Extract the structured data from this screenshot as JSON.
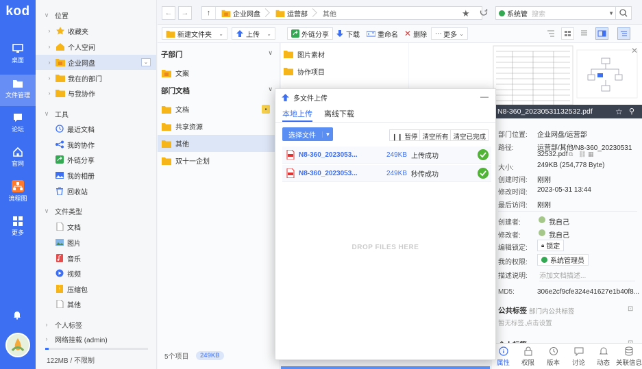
{
  "rail": {
    "logo": "kod",
    "items": [
      {
        "label": "桌面",
        "icon": "desktop-icon"
      },
      {
        "label": "文件管理",
        "icon": "folder-icon"
      },
      {
        "label": "论坛",
        "icon": "forum-icon"
      },
      {
        "label": "官网",
        "icon": "home-icon"
      },
      {
        "label": "流程图",
        "icon": "flowchart-icon"
      },
      {
        "label": "更多",
        "icon": "grid-icon"
      }
    ]
  },
  "tree": {
    "location_header": "位置",
    "location_items": [
      {
        "label": "收藏夹",
        "icon": "star-icon"
      },
      {
        "label": "个人空间",
        "icon": "house-icon"
      },
      {
        "label": "企业网盘",
        "icon": "enterprise-folder-icon"
      },
      {
        "label": "我在的部门",
        "icon": "folder-icon"
      },
      {
        "label": "与我协作",
        "icon": "folder-icon"
      }
    ],
    "tools_header": "工具",
    "tools_items": [
      {
        "label": "最近文档",
        "icon": "clock-icon"
      },
      {
        "label": "我的协作",
        "icon": "share-nodes-icon"
      },
      {
        "label": "外链分享",
        "icon": "link-share-icon"
      },
      {
        "label": "我的相册",
        "icon": "album-icon"
      },
      {
        "label": "回收站",
        "icon": "trash-icon"
      }
    ],
    "types_header": "文件类型",
    "types_items": [
      {
        "label": "文档",
        "icon": "doc-icon"
      },
      {
        "label": "图片",
        "icon": "image-icon"
      },
      {
        "label": "音乐",
        "icon": "music-icon"
      },
      {
        "label": "视频",
        "icon": "video-icon"
      },
      {
        "label": "压缩包",
        "icon": "zip-icon"
      },
      {
        "label": "其他",
        "icon": "file-icon"
      }
    ],
    "tags_header": "个人标签",
    "network_header": "网络挂载 (admin)",
    "quota": "122MB / 不限制"
  },
  "topbar": {
    "crumbs": [
      "企业网盘",
      "运营部",
      "其他"
    ],
    "user_label": "系统管",
    "search_placeholder": "搜索"
  },
  "toolbar": {
    "new_folder": "新建文件夹",
    "upload": "上传",
    "share": "外链分享",
    "download": "下载",
    "rename": "重命名",
    "delete": "删除",
    "more": "更多"
  },
  "pane1": {
    "sub_header": "子部门",
    "sub_items": [
      "文案"
    ],
    "dept_header": "部门文档",
    "dept_items": [
      "文档",
      "共享资源",
      "其他",
      "双十一企划"
    ],
    "footer_count": "5个项目",
    "footer_size": "249KB"
  },
  "pane2": {
    "items": [
      "图片素材",
      "协作项目"
    ]
  },
  "dialog": {
    "title": "多文件上传",
    "tab_local": "本地上传",
    "tab_offline": "离线下载",
    "pick": "选择文件",
    "pause": "暂停",
    "clear_all": "清空所有",
    "clear_done": "清空已完成",
    "files": [
      {
        "name": "N8-360_2023053...",
        "size": "249KB",
        "status": "上传成功"
      },
      {
        "name": "N8-360_2023053...",
        "size": "249KB",
        "status": "秒传成功"
      }
    ],
    "drop_hint": "DROP FILES HERE"
  },
  "info": {
    "file_title": "N8-360_20230531132532.pdf",
    "rows": [
      {
        "k": "部门位置:",
        "v": "企业网盘/运营部"
      },
      {
        "k": "路径:",
        "v": "运营部/其他/N8-360_20230531"
      },
      {
        "k": "",
        "v": "32532.pdf"
      },
      {
        "k": "大小:",
        "v": "249KB (254,778 Byte)"
      },
      {
        "k": "创建时间:",
        "v": "刚刚"
      },
      {
        "k": "修改时间:",
        "v": "2023-05-31 13:44"
      },
      {
        "k": "最后访问:",
        "v": "刚刚"
      },
      {
        "k": "创建者:",
        "v": "我自己"
      },
      {
        "k": "修改者:",
        "v": "我自己"
      },
      {
        "k": "编辑锁定:",
        "v": "锁定"
      },
      {
        "k": "我的权限:",
        "v": "系统管理员"
      },
      {
        "k": "描述说明:",
        "v": "添加文档描述..."
      },
      {
        "k": "MD5:",
        "v": "306e2cf9cfe324e41627e1b40f8..."
      }
    ],
    "public_tags": "公共标签",
    "public_tags_sub": "部门内公共标签",
    "no_tags": "暂无标签,点击设置",
    "personal_tags": "个人标签",
    "tabs": [
      "属性",
      "权限",
      "版本",
      "讨论",
      "动态",
      "关联信息"
    ]
  }
}
